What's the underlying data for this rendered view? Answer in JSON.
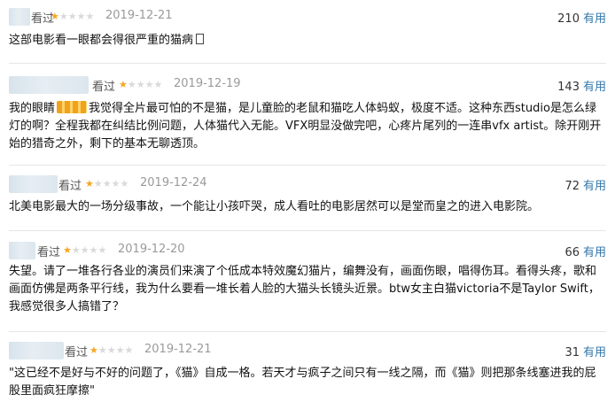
{
  "reviews": [
    {
      "watched": "看过",
      "stars": [
        "★",
        "★",
        "★",
        "★",
        "★"
      ],
      "rating_stars": 1,
      "date": "2019-12-21",
      "votes": "210",
      "useful_label": "有用",
      "content": "这部电影看一眼都会得很严重的猫病"
    },
    {
      "watched": "看过",
      "stars": [
        "★",
        "★",
        "★",
        "★",
        "★"
      ],
      "rating_stars": 1,
      "date": "2019-12-19",
      "votes": "143",
      "useful_label": "有用",
      "content_prefix": "我的眼睛",
      "content": "我觉得全片最可怕的不是猫，是儿童脸的老鼠和猫吃人体蚂蚁，极度不适。这种东西studio是怎么绿灯的啊？全程我都在纠结比例问题，人体猫代入无能。VFX明显没做完吧，心疼片尾列的一连串vfx artist。除开刚开始的猎奇之外，剩下的基本无聊透顶。"
    },
    {
      "watched": "看过",
      "stars": [
        "★",
        "★",
        "★",
        "★",
        "★"
      ],
      "rating_stars": 1,
      "date": "2019-12-24",
      "votes": "72",
      "useful_label": "有用",
      "content": "北美电影最大的一场分级事故，一个能让小孩吓哭，成人看吐的电影居然可以是堂而皇之的进入电影院。"
    },
    {
      "watched": "看过",
      "stars": [
        "★",
        "★",
        "★",
        "★",
        "★"
      ],
      "rating_stars": 1,
      "date": "2019-12-20",
      "votes": "66",
      "useful_label": "有用",
      "content": "失望。请了一堆各行各业的演员们来演了个低成本特效魔幻猫片，编舞没有，画面伤眼，唱得伤耳。看得头疼，歌和画面仿佛是两条平行线，我为什么要看一堆长着人脸的大猫头长镜头近景。btw女主白猫victoria不是Taylor Swift，我感觉很多人搞错了？"
    },
    {
      "watched": "看过",
      "stars": [
        "★",
        "★",
        "★",
        "★",
        "★"
      ],
      "rating_stars": 1,
      "date": "2019-12-21",
      "votes": "31",
      "useful_label": "有用",
      "content": "\"这已经不是好与不好的问题了，《猫》自成一格。若天才与疯子之间只有一线之隔，而《猫》则把那条线塞进我的屁股里面疯狂摩擦\""
    }
  ],
  "colors": {
    "star_on": "#f5a623",
    "star_off": "#d9d9d9",
    "useful": "#3377aa",
    "date": "#9a9a9a"
  }
}
